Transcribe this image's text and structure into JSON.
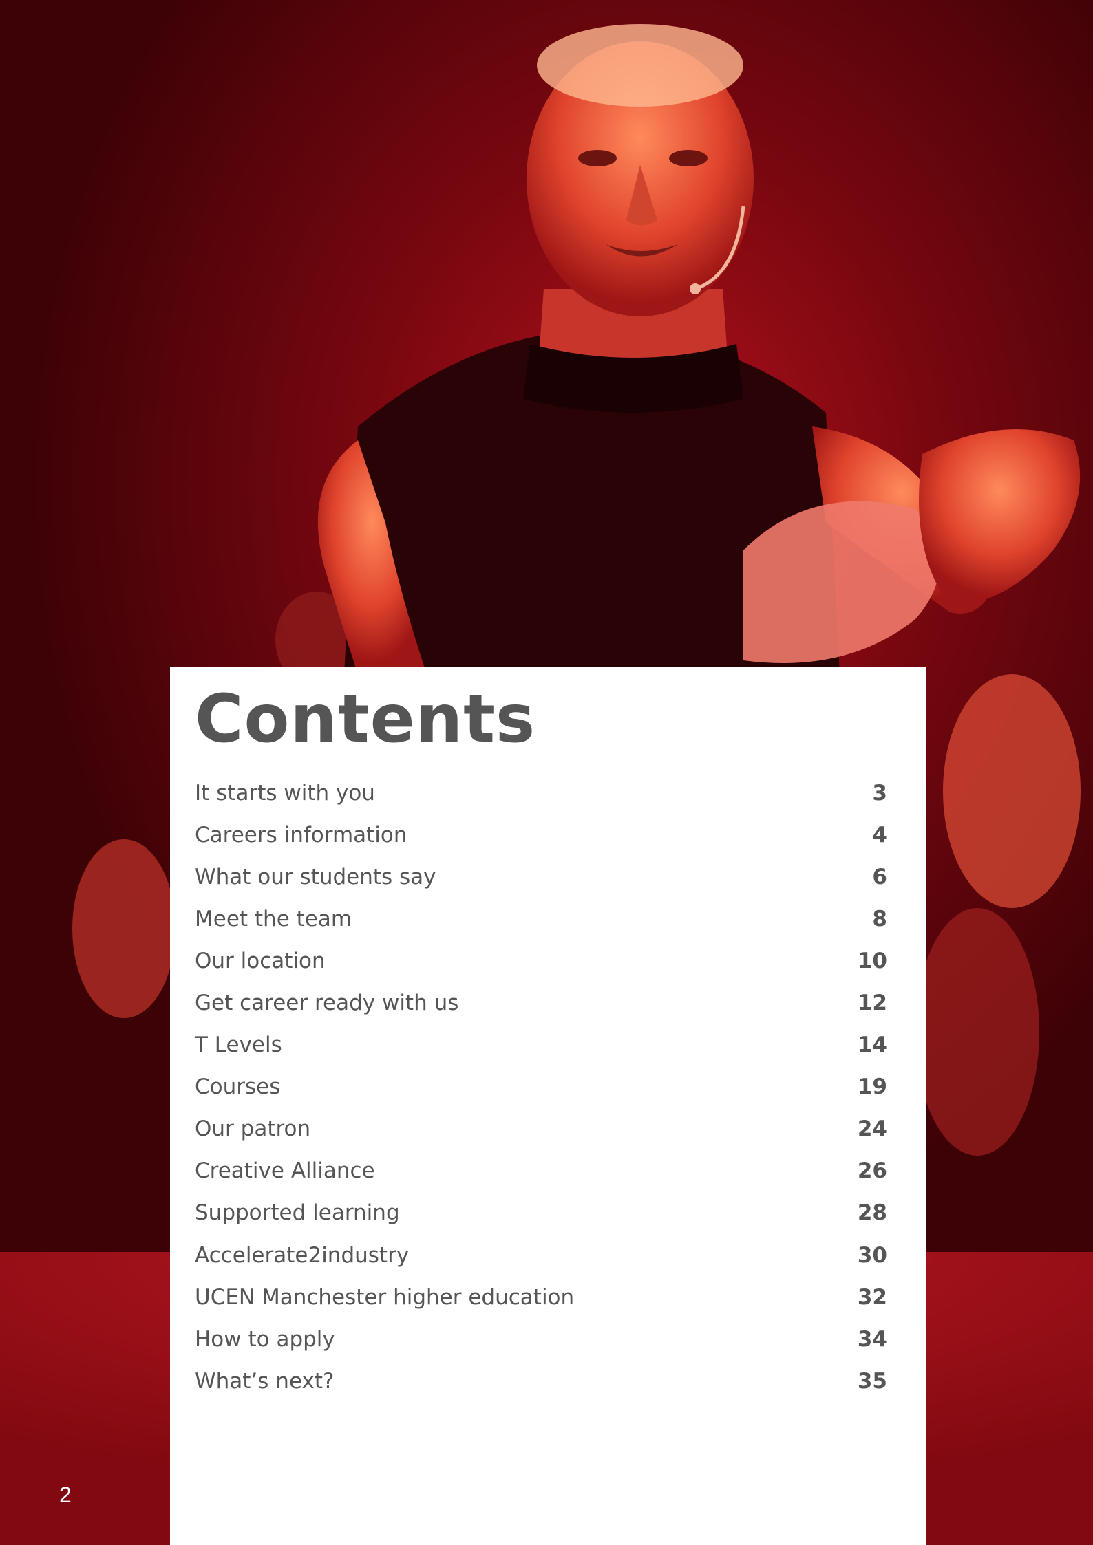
{
  "page": {
    "number": "2"
  },
  "contents": {
    "title": "Contents",
    "items": [
      {
        "label": "It starts with you",
        "page": "3"
      },
      {
        "label": "Careers information",
        "page": "4"
      },
      {
        "label": "What our students say",
        "page": "6"
      },
      {
        "label": "Meet the team",
        "page": "8"
      },
      {
        "label": "Our location",
        "page": "10"
      },
      {
        "label": "Get career ready with us",
        "page": "12"
      },
      {
        "label": "T Levels",
        "page": "14"
      },
      {
        "label": "Courses",
        "page": "19"
      },
      {
        "label": "Our patron",
        "page": "24"
      },
      {
        "label": "Creative Alliance",
        "page": "26"
      },
      {
        "label": "Supported learning",
        "page": "28"
      },
      {
        "label": "Accelerate2industry",
        "page": "30"
      },
      {
        "label": "UCEN Manchester higher education",
        "page": "32"
      },
      {
        "label": "How to apply",
        "page": "34"
      },
      {
        "label": "What’s next?",
        "page": "35"
      }
    ]
  },
  "colors": {
    "text": "#555555",
    "panel": "#ffffff",
    "photo_tint": "#b3121c"
  }
}
